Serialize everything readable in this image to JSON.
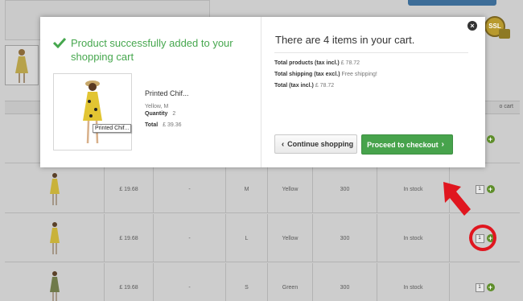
{
  "modal": {
    "success_title": "Product successfully added to your shopping cart",
    "product": {
      "name": "Printed Chif...",
      "tooltip": "Printed Chif...",
      "attributes": "Yellow, M",
      "quantity_label": "Quantity",
      "quantity_value": "2",
      "total_label": "Total",
      "total_value": "£ 39.36"
    },
    "cart_count": "There are 4 items in your cart.",
    "summary": {
      "products_label": "Total products (tax incl.)",
      "products_value": "£ 78.72",
      "shipping_label": "Total shipping (tax excl.)",
      "shipping_value": "Free shipping!",
      "total_label": "Total (tax incl.)",
      "total_value": "£ 78.72"
    },
    "buttons": {
      "continue": "Continue shopping",
      "checkout": "Proceed to checkout"
    },
    "close_icon": "close-icon"
  },
  "background": {
    "ssl_badge": "SSL",
    "header_partial": "o cart",
    "rows": [
      {
        "price": "",
        "dash": "",
        "size": "",
        "color": "",
        "qty_stock": "",
        "stock": "",
        "qty": "1"
      },
      {
        "price": "£ 19.68",
        "dash": "-",
        "size": "M",
        "color": "Yellow",
        "qty_stock": "300",
        "stock": "In stock",
        "qty": "1"
      },
      {
        "price": "£ 19.68",
        "dash": "-",
        "size": "L",
        "color": "Yellow",
        "qty_stock": "300",
        "stock": "In stock",
        "qty": "1"
      },
      {
        "price": "£ 19.68",
        "dash": "-",
        "size": "S",
        "color": "Green",
        "qty_stock": "300",
        "stock": "In stock",
        "qty": "1"
      }
    ]
  },
  "colors": {
    "success_green": "#46a74e",
    "checkout_green": "#47a34c",
    "annotation_red": "#e0161f"
  }
}
